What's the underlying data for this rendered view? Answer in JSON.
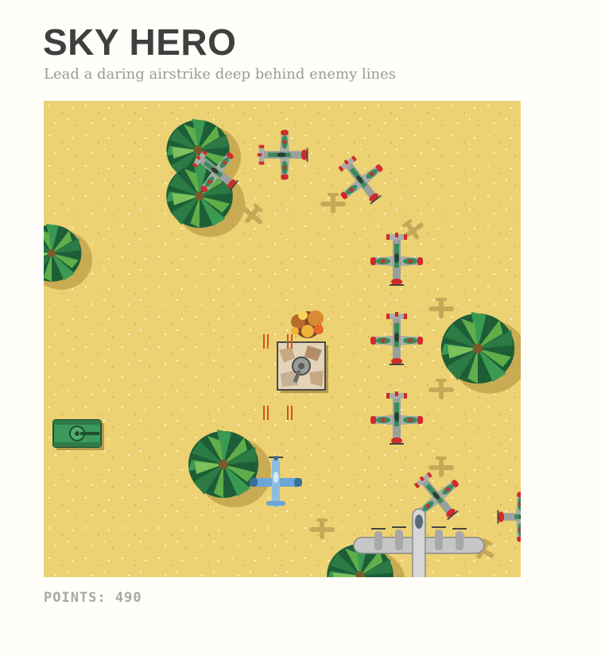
{
  "header": {
    "title": "SKY HERO",
    "subtitle": "Lead a daring airstrike deep behind enemy lines"
  },
  "hud": {
    "points_label": "POINTS:",
    "points_value": "490"
  },
  "colors": {
    "sand": "#ecd273",
    "palm_dark": "#1f6b3c",
    "palm_light": "#5fae4a",
    "enemy_green": "#3c8a5a",
    "enemy_red": "#d22a2a",
    "player_blue": "#5a9fd4",
    "bomber_grey": "#b8b8b8",
    "tank_green": "#3c9a5c"
  },
  "sprites": {
    "player": "player-fighter-plane",
    "enemies": "enemy-fighter-plane",
    "bomber": "heavy-bomber-plane",
    "ground": [
      "camo-bunker",
      "green-tank",
      "explosion",
      "palm-tree"
    ]
  }
}
